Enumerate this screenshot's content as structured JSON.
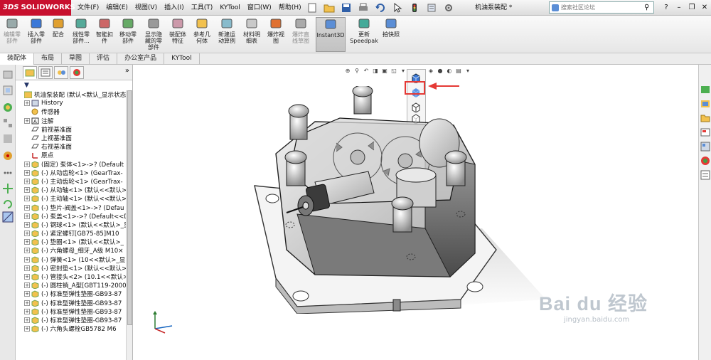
{
  "app": {
    "logo_prefix": "3DS",
    "logo_name": "SOLIDWORKS",
    "document_title": "机油泵装配 *"
  },
  "menubar": {
    "items": [
      "文件(F)",
      "编辑(E)",
      "视图(V)",
      "插入(I)",
      "工具(T)",
      "KYTool",
      "窗口(W)",
      "帮助(H)"
    ]
  },
  "search": {
    "placeholder": "搜索社区论坛"
  },
  "ribbon": {
    "buttons": [
      {
        "label": "编辑零\n部件",
        "icon": "edit-component-icon",
        "dim": true
      },
      {
        "label": "插入零\n部件",
        "icon": "insert-component-icon"
      },
      {
        "label": "配合",
        "icon": "mate-icon"
      },
      {
        "label": "线性零\n部件...",
        "icon": "linear-pattern-icon"
      },
      {
        "label": "智能扣\n件",
        "icon": "smart-fasteners-icon"
      },
      {
        "label": "移动零\n部件",
        "icon": "move-component-icon"
      },
      {
        "label": "显示隐\n藏的零\n部件",
        "icon": "show-hidden-icon"
      },
      {
        "label": "装配体\n特征",
        "icon": "assembly-feature-icon"
      },
      {
        "label": "参考几\n何体",
        "icon": "reference-geometry-icon"
      },
      {
        "label": "新建运\n动算例",
        "icon": "new-motion-study-icon"
      },
      {
        "label": "材料明\n细表",
        "icon": "bom-icon"
      },
      {
        "label": "爆炸视\n图",
        "icon": "exploded-view-icon"
      },
      {
        "label": "爆炸直\n线草图",
        "icon": "explode-line-sketch-icon",
        "dim": true
      },
      {
        "label": "Instant3D",
        "icon": "instant3d-icon",
        "active": true
      },
      {
        "label": "更新\nSpeedpak",
        "icon": "speedpak-icon"
      },
      {
        "label": "拍快照",
        "icon": "snapshot-icon"
      }
    ]
  },
  "tabs": [
    {
      "label": "装配体",
      "active": true
    },
    {
      "label": "布局"
    },
    {
      "label": "草图"
    },
    {
      "label": "评估"
    },
    {
      "label": "办公室产品"
    },
    {
      "label": "KYTool"
    }
  ],
  "feature_tree": {
    "root": "机油泵装配 (默认<默认_显示状态",
    "nodes": [
      {
        "label": "History",
        "icon": "history-icon",
        "exp": true
      },
      {
        "label": "传感器",
        "icon": "sensor-icon",
        "exp": false
      },
      {
        "label": "注解",
        "icon": "annotation-icon",
        "exp": true
      },
      {
        "label": "前视基准面",
        "icon": "plane-icon",
        "exp": false
      },
      {
        "label": "上视基准面",
        "icon": "plane-icon",
        "exp": false
      },
      {
        "label": "右视基准面",
        "icon": "plane-icon",
        "exp": false
      },
      {
        "label": "原点",
        "icon": "origin-icon",
        "exp": false
      },
      {
        "label": "(固定) 泵体<1>->? (Default",
        "icon": "part-icon",
        "exp": true
      },
      {
        "label": "(-) 从动齿轮<1> (GearTrax-",
        "icon": "part-icon",
        "exp": true
      },
      {
        "label": "(-) 主动齿轮<1> (GearTrax-",
        "icon": "part-icon",
        "exp": true
      },
      {
        "label": "(-) 从动轴<1> (默认<<默认>",
        "icon": "part-icon",
        "exp": true
      },
      {
        "label": "(-) 主动轴<1> (默认<<默认>",
        "icon": "part-icon",
        "exp": true
      },
      {
        "label": "(-) 垫片-阀盖<1>->? (Defau",
        "icon": "part-icon",
        "exp": true
      },
      {
        "label": "(-) 泵盖<1>->? (Default<<D",
        "icon": "part-icon",
        "exp": true
      },
      {
        "label": "(-) 钢球<1> (默认<<默认>_显",
        "icon": "part-icon",
        "exp": true
      },
      {
        "label": "(-) 紧定螺钉[GB75-85]M10",
        "icon": "part-icon",
        "exp": true
      },
      {
        "label": "(-) 垫圈<1> (默认<<默认>_",
        "icon": "part-icon",
        "exp": true
      },
      {
        "label": "(-) 六角螺母_细牙_A级 M10×",
        "icon": "part-icon",
        "exp": true
      },
      {
        "label": "(-) 弹簧<1> (10<<默认>_显",
        "icon": "part-icon",
        "exp": true
      },
      {
        "label": "(-) 密封垫<1> (默认<<默认>",
        "icon": "part-icon",
        "exp": true
      },
      {
        "label": "(-) 管接头<2> (10.1<<默认>",
        "icon": "part-icon",
        "exp": true
      },
      {
        "label": "(-) 圆柱销_A型[GBT119-2000",
        "icon": "part-icon",
        "exp": true
      },
      {
        "label": "(-) 标准型弹性垫圈-GB93-87",
        "icon": "part-icon",
        "exp": true
      },
      {
        "label": "(-) 标准型弹性垫圈-GB93-87",
        "icon": "part-icon",
        "exp": true
      },
      {
        "label": "(-) 标准型弹性垫圈-GB93-87",
        "icon": "part-icon",
        "exp": true
      },
      {
        "label": "(-) 标准型弹性垫圈-GB93-87",
        "icon": "part-icon",
        "exp": true
      },
      {
        "label": "(-) 六角头螺栓GB5782 M6",
        "icon": "part-icon",
        "exp": true
      }
    ]
  },
  "watermark": {
    "main": "Bai du 经验",
    "sub": "jingyan.baidu.com"
  },
  "colors": {
    "brand": "#c8102e",
    "highlight": "#e53935",
    "selection_blue": "#2e6fd8"
  }
}
